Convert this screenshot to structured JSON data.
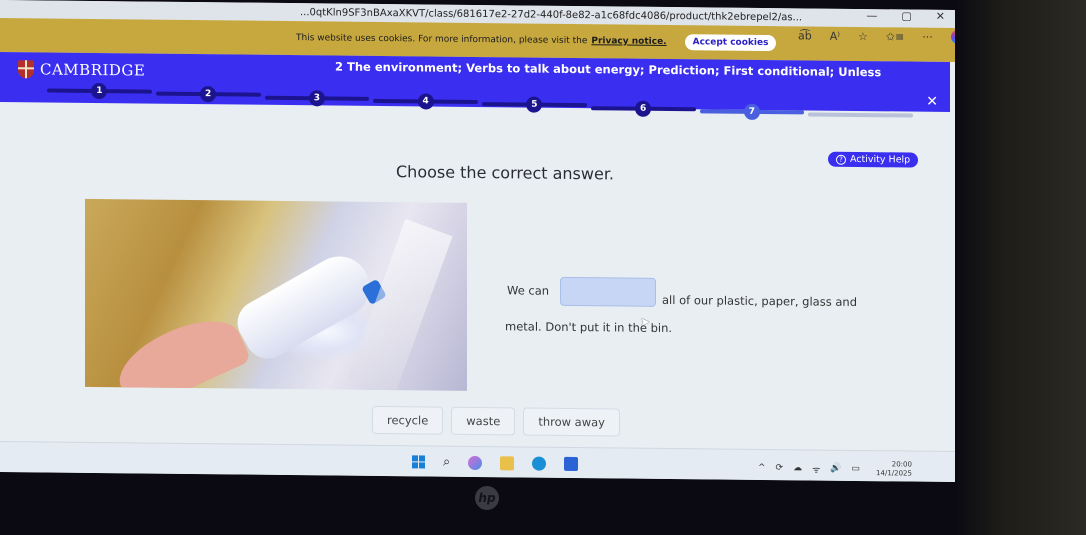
{
  "browser": {
    "url": "...0qtKln9SF3nBAxaXKVT/class/681617e2-27d2-440f-8e82-a1c68fdc4086/product/thk2ebrepel2/as...",
    "window_controls": {
      "minimize": "—",
      "restore": "▢",
      "close": "✕"
    },
    "toolbar_icons": {
      "read_aloud": "a͡b",
      "immersive": "A⁾",
      "favorite": "☆",
      "favorites": "✩≡",
      "more": "···"
    }
  },
  "cookie_banner": {
    "text": "This website uses cookies. For more information, please visit the",
    "link": "Privacy notice.",
    "accept_label": "Accept cookies"
  },
  "header": {
    "logo_text": "CAMBRIDGE",
    "unit_title": "2 The environment; Verbs to talk about energy; Prediction; First conditional; Unless",
    "close_label": "✕"
  },
  "progress": {
    "steps": [
      "1",
      "2",
      "3",
      "4",
      "5",
      "6",
      "7"
    ],
    "current_step": 7,
    "total_segments": 8
  },
  "help": {
    "label": "Activity Help",
    "icon": "?"
  },
  "activity": {
    "instruction": "Choose the correct answer.",
    "sentence_before": "We can",
    "sentence_after": "all of our plastic, paper, glass and",
    "sentence_line2": "metal. Don't put it in the bin.",
    "options": [
      "recycle",
      "waste",
      "throw away"
    ]
  },
  "taskbar": {
    "time": "20:00",
    "date": "14/1/2025",
    "tray": [
      "^",
      "⟳",
      "☁",
      "ᯤ",
      "🔊",
      "▭"
    ]
  },
  "device": {
    "brand": "hp"
  }
}
